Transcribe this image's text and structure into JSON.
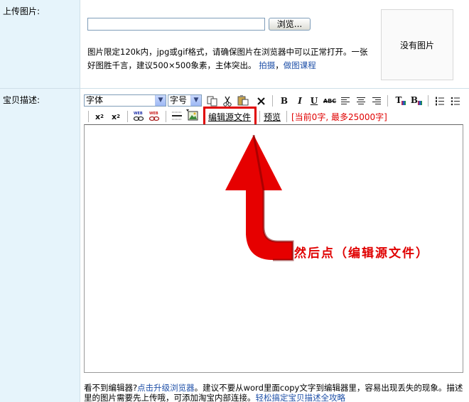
{
  "upload": {
    "label": "上传图片:",
    "browse_label": "浏览...",
    "hint_text": "图片限定120k内，jpg或gif格式，请确保图片在浏览器中可以正常打开。一张好图胜千言，建议500×500象素，主体突出。",
    "hint_link1": "拍摄",
    "hint_sep": "，",
    "hint_link2": "做图课程",
    "no_image_text": "没有图片"
  },
  "description": {
    "label": "宝贝描述:",
    "font_select": "字体",
    "size_select": "字号",
    "edit_source_label": "编辑源文件",
    "preview_label": "预览",
    "counter_text": "[当前0字, 最多25000字]",
    "instruction_text": "然后点（编辑源文件）",
    "foot_text1": "看不到编辑器?",
    "foot_link1": "点击升级浏览器",
    "foot_text2": "。建议不要从word里面copy文字到编辑器里，容易出现丢失的现象。描述里的图片需要先上传哦，可添加淘宝内部连接。",
    "foot_link2": "轻松搞定宝贝描述全攻略"
  },
  "colors": {
    "label_bg": "#e6f4fb",
    "accent_red": "#e00000",
    "link_blue": "#1f50a8"
  }
}
